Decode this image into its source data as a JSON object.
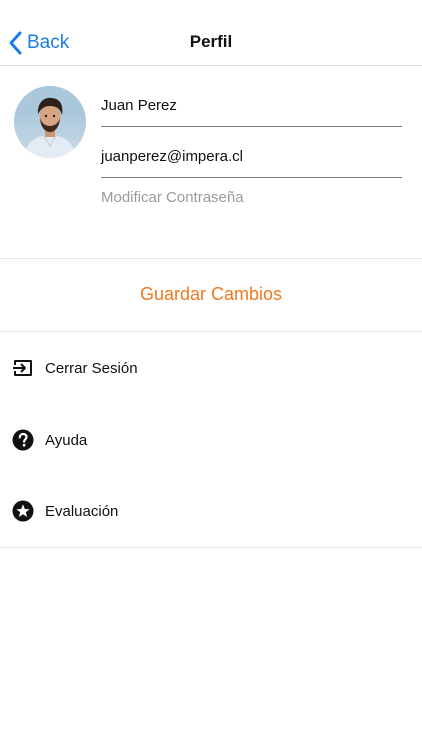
{
  "navbar": {
    "back_label": "Back",
    "title": "Perfil"
  },
  "profile": {
    "name": "Juan Perez",
    "email": "juanperez@impera.cl",
    "modify_password_label": "Modificar Contraseña"
  },
  "actions": {
    "save_label": "Guardar Cambios"
  },
  "menu": {
    "items": [
      {
        "label": "Cerrar Sesión",
        "icon": "logout-icon"
      },
      {
        "label": "Ayuda",
        "icon": "help-icon"
      },
      {
        "label": "Evaluación",
        "icon": "star-icon"
      }
    ]
  },
  "colors": {
    "accent_blue": "#1a7ee3",
    "accent_orange": "#f0781f",
    "placeholder_gray": "#9a9a9a"
  }
}
